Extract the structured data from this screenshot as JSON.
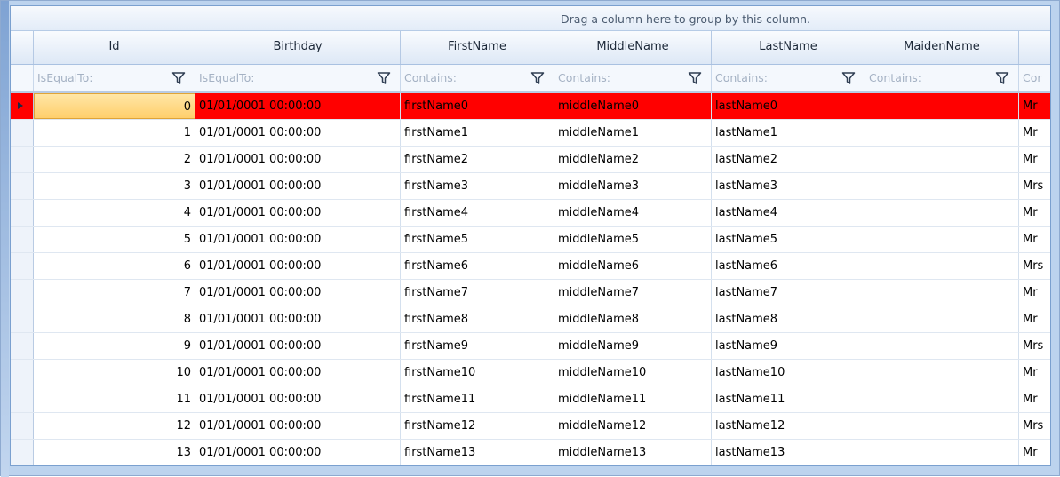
{
  "grid": {
    "group_panel_text": "Drag a column here to group by this column.",
    "columns": [
      {
        "header": "Id",
        "filter_placeholder": "IsEqualTo:"
      },
      {
        "header": "Birthday",
        "filter_placeholder": "IsEqualTo:"
      },
      {
        "header": "FirstName",
        "filter_placeholder": "Contains:"
      },
      {
        "header": "MiddleName",
        "filter_placeholder": "Contains:"
      },
      {
        "header": "LastName",
        "filter_placeholder": "Contains:"
      },
      {
        "header": "MaidenName",
        "filter_placeholder": "Contains:"
      },
      {
        "header": "",
        "filter_placeholder": "Cor"
      }
    ],
    "selected_row_color": "#ff0000",
    "rows": [
      {
        "id": "0",
        "birthday": "01/01/0001 00:00:00",
        "first": "firstName0",
        "middle": "middleName0",
        "last": "lastName0",
        "maiden": "",
        "title": "Mr"
      },
      {
        "id": "1",
        "birthday": "01/01/0001 00:00:00",
        "first": "firstName1",
        "middle": "middleName1",
        "last": "lastName1",
        "maiden": "",
        "title": "Mr"
      },
      {
        "id": "2",
        "birthday": "01/01/0001 00:00:00",
        "first": "firstName2",
        "middle": "middleName2",
        "last": "lastName2",
        "maiden": "",
        "title": "Mr"
      },
      {
        "id": "3",
        "birthday": "01/01/0001 00:00:00",
        "first": "firstName3",
        "middle": "middleName3",
        "last": "lastName3",
        "maiden": "",
        "title": "Mrs"
      },
      {
        "id": "4",
        "birthday": "01/01/0001 00:00:00",
        "first": "firstName4",
        "middle": "middleName4",
        "last": "lastName4",
        "maiden": "",
        "title": "Mr"
      },
      {
        "id": "5",
        "birthday": "01/01/0001 00:00:00",
        "first": "firstName5",
        "middle": "middleName5",
        "last": "lastName5",
        "maiden": "",
        "title": "Mr"
      },
      {
        "id": "6",
        "birthday": "01/01/0001 00:00:00",
        "first": "firstName6",
        "middle": "middleName6",
        "last": "lastName6",
        "maiden": "",
        "title": "Mrs"
      },
      {
        "id": "7",
        "birthday": "01/01/0001 00:00:00",
        "first": "firstName7",
        "middle": "middleName7",
        "last": "lastName7",
        "maiden": "",
        "title": "Mr"
      },
      {
        "id": "8",
        "birthday": "01/01/0001 00:00:00",
        "first": "firstName8",
        "middle": "middleName8",
        "last": "lastName8",
        "maiden": "",
        "title": "Mr"
      },
      {
        "id": "9",
        "birthday": "01/01/0001 00:00:00",
        "first": "firstName9",
        "middle": "middleName9",
        "last": "lastName9",
        "maiden": "",
        "title": "Mrs"
      },
      {
        "id": "10",
        "birthday": "01/01/0001 00:00:00",
        "first": "firstName10",
        "middle": "middleName10",
        "last": "lastName10",
        "maiden": "",
        "title": "Mr"
      },
      {
        "id": "11",
        "birthday": "01/01/0001 00:00:00",
        "first": "firstName11",
        "middle": "middleName11",
        "last": "lastName11",
        "maiden": "",
        "title": "Mr"
      },
      {
        "id": "12",
        "birthday": "01/01/0001 00:00:00",
        "first": "firstName12",
        "middle": "middleName12",
        "last": "lastName12",
        "maiden": "",
        "title": "Mrs"
      },
      {
        "id": "13",
        "birthday": "01/01/0001 00:00:00",
        "first": "firstName13",
        "middle": "middleName13",
        "last": "lastName13",
        "maiden": "",
        "title": "Mr"
      }
    ]
  }
}
